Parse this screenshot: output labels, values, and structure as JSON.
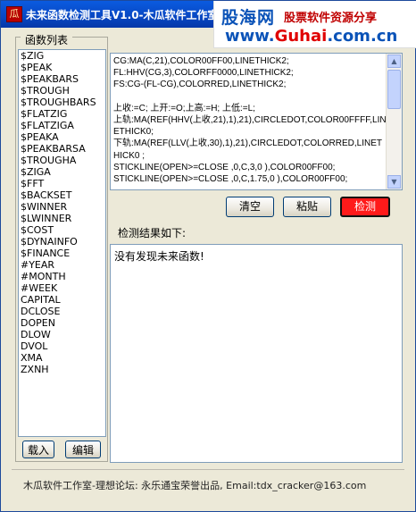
{
  "window": {
    "title": "未来函数检测工具V1.0-木瓜软件工作室"
  },
  "ad": {
    "logo": "股海网",
    "slogan": "股票软件资源分享",
    "url_prefix": "www.",
    "url_brand": "Guhai",
    "url_suffix": ".com.cn"
  },
  "sidebar": {
    "group_label": "函数列表",
    "items": [
      "$ZIG",
      "$PEAK",
      "$PEAKBARS",
      "$TROUGH",
      "$TROUGHBARS",
      "$FLATZIG",
      "$FLATZIGA",
      "$PEAKA",
      "$PEAKBARSA",
      "$TROUGHA",
      "$ZIGA",
      "$FFT",
      "$BACKSET",
      "$WINNER",
      "$LWINNER",
      "$COST",
      "$DYNAINFO",
      "$FINANCE",
      "#YEAR",
      "#MONTH",
      "#WEEK",
      "CAPITAL",
      "DCLOSE",
      "DOPEN",
      "DLOW",
      "DVOL",
      "XMA",
      "ZXNH"
    ],
    "load_button": "载入",
    "edit_button": "编辑"
  },
  "editor": {
    "code": "CG:MA(C,21),COLOR00FF00,LINETHICK2;\nFL:HHV(CG,3),COLORFF0000,LINETHICK2;\nFS:CG-(FL-CG),COLORRED,LINETHICK2;\n\n上收:=C; 上开:=O;上高:=H; 上低:=L;\n上轨:MA(REF(HHV(上收,21),1),21),CIRCLEDOT,COLOR00FFFF,LINETHICK0;\n下轨:MA(REF(LLV(上收,30),1),21),CIRCLEDOT,COLORRED,LINETHICK0 ;\nSTICKLINE(OPEN>=CLOSE ,0,C,3,0 ),COLOR00FF00;\nSTICKLINE(OPEN>=CLOSE ,0,C,1.75,0 ),COLOR00FF00;"
  },
  "buttons": {
    "clear": "清空",
    "paste": "粘贴",
    "detect": "检测"
  },
  "result": {
    "label": "检测结果如下:",
    "text": "没有发现未来函数!"
  },
  "status": {
    "text": "木瓜软件工作室-理想论坛: 永乐通宝荣誉出品, Email:tdx_cracker@163.com"
  }
}
